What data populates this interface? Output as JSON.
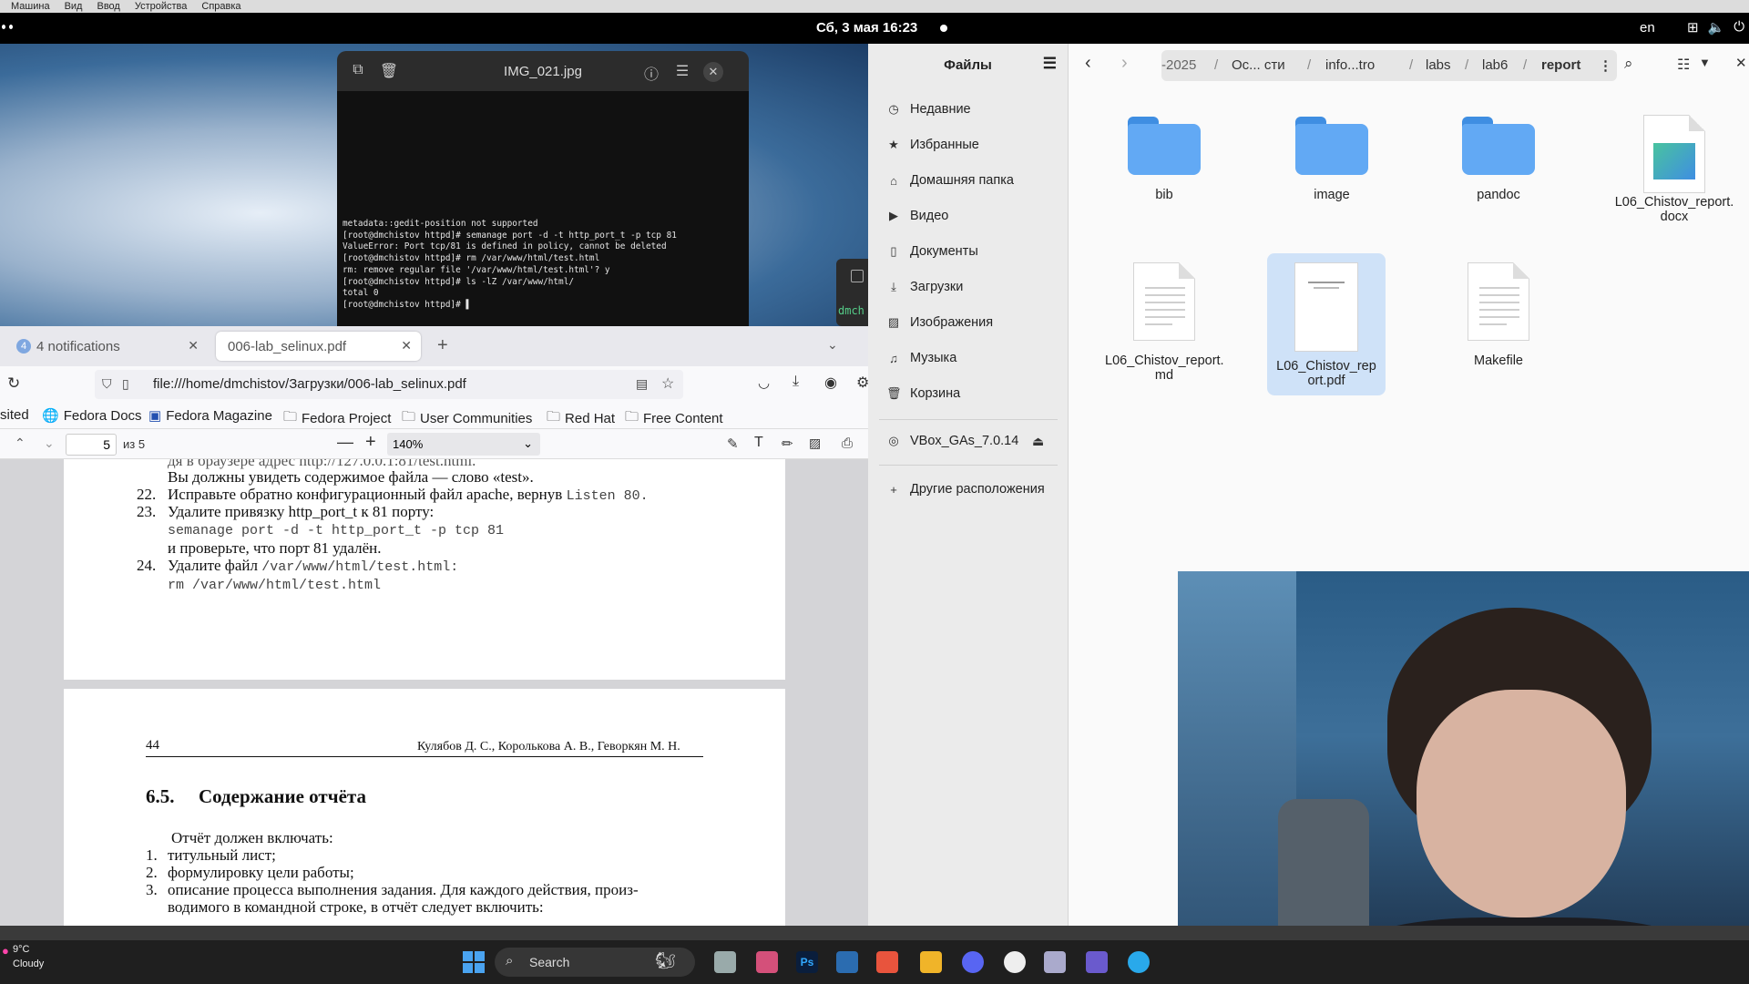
{
  "vbox_menu": [
    "Машина",
    "Вид",
    "Ввод",
    "Устройства",
    "Справка"
  ],
  "topbar": {
    "clock": "Сб, 3 мая 16:23",
    "lang": "en"
  },
  "viewer": {
    "title": "IMG_021.jpg",
    "terminal_lines": [
      "metadata::gedit-position not supported",
      "[root@dmchistov httpd]# semanage port -d -t http_port_t -p tcp 81",
      "ValueError: Port tcp/81 is defined in policy, cannot be deleted",
      "[root@dmchistov httpd]# rm /var/www/html/test.html",
      "rm: remove regular file '/var/www/html/test.html'? y",
      "[root@dmchistov httpd]# ls -lZ /var/www/html/",
      "total 0",
      "[root@dmchistov httpd]# ▌"
    ],
    "side_peek_text": "dmch"
  },
  "firefox": {
    "tabs": [
      {
        "badge": "4",
        "label": "4 notifications"
      },
      {
        "label": "006-lab_selinux.pdf"
      }
    ],
    "url": "file:///home/dmchistov/Загрузки/006-lab_selinux.pdf",
    "bookmarks": [
      "sited",
      "Fedora Docs",
      "Fedora Magazine",
      "Fedora Project",
      "User Communities",
      "Red Hat",
      "Free Content"
    ],
    "pdf_toolbar": {
      "page": "5",
      "of": "из 5",
      "zoom": "140%"
    },
    "page1": {
      "cut_line": "дя в браузере адрес http://127.0.0.1:81/test.html.",
      "line1": "Вы должны увидеть содержимое файла — слово «test».",
      "item22_num": "22.",
      "item22_text": "Исправьте обратно конфигурационный файл apache, вернув",
      "item22_code": "Listen 80.",
      "item23_num": "23.",
      "item23_text": "Удалите привязку http_port_t к 81 порту:",
      "item23_code": "semanage port -d -t http_port_t -p tcp 81",
      "item23_after": "и проверьте, что порт 81 удалён.",
      "item24_num": "24.",
      "item24_text": "Удалите файл",
      "item24_inline": "/var/www/html/test.html:",
      "item24_code": "rm /var/www/html/test.html"
    },
    "page2": {
      "page_num": "44",
      "authors": "Кулябов Д. С., Королькова А. В., Геворкян М. Н.",
      "section_num": "6.5.",
      "section_title": "Содержание отчёта",
      "intro": "Отчёт должен включать:",
      "items": [
        {
          "n": "1.",
          "t": "титульный лист;"
        },
        {
          "n": "2.",
          "t": "формулировку цели работы;"
        },
        {
          "n": "3.",
          "t": "описание процесса выполнения задания. Для каждого действия, произ-"
        }
      ],
      "cont": "водимого в командной строке, в отчёт следует включить:"
    }
  },
  "files": {
    "title": "Файлы",
    "sidebar": [
      {
        "icon": "clock-icon",
        "label": "Недавние"
      },
      {
        "icon": "star-icon",
        "label": "Избранные"
      },
      {
        "icon": "home-icon",
        "label": "Домашняя папка"
      },
      {
        "icon": "video-icon",
        "label": "Видео"
      },
      {
        "icon": "document-icon",
        "label": "Документы"
      },
      {
        "icon": "download-icon",
        "label": "Загрузки"
      },
      {
        "icon": "image-icon",
        "label": "Изображения"
      },
      {
        "icon": "music-icon",
        "label": "Музыка"
      },
      {
        "icon": "trash-icon",
        "label": "Корзина"
      }
    ],
    "device": "VBox_GAs_7.0.14",
    "other": "Другие расположения",
    "path": [
      "-2025",
      "Ос... сти",
      "info...tro",
      "labs",
      "lab6",
      "report"
    ],
    "items": [
      {
        "name": "bib",
        "type": "folder"
      },
      {
        "name": "image",
        "type": "folder"
      },
      {
        "name": "pandoc",
        "type": "folder"
      },
      {
        "name": "L06_Chistov_report.docx",
        "line1": "L06_Chistov_report.",
        "line2": "docx",
        "type": "docx"
      },
      {
        "name": "L06_Chistov_report.md",
        "line1": "L06_Chistov_report.",
        "line2": "md",
        "type": "text"
      },
      {
        "name": "L06_Chistov_report.pdf",
        "line1": "L06_Chistov_rep",
        "line2": "ort.pdf",
        "type": "pdf",
        "selected": true
      },
      {
        "name": "Makefile",
        "type": "text"
      }
    ]
  },
  "taskbar": {
    "weather_temp": "9°C",
    "weather_desc": "Cloudy",
    "search": "Search"
  }
}
